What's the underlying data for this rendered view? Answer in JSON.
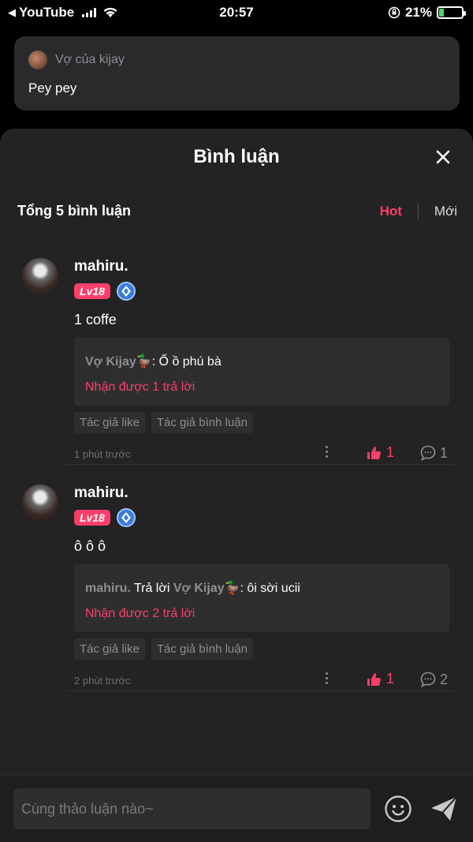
{
  "status_bar": {
    "back_app": "YouTube",
    "time": "20:57",
    "battery_pct": "21%",
    "battery_level": 0.21
  },
  "top_message": {
    "username": "Vợ của kijay",
    "text": "Pey pey"
  },
  "sheet": {
    "title": "Bình luận",
    "total_label": "Tổng 5 bình luận",
    "sort_hot": "Hot",
    "sort_new": "Mới"
  },
  "comments": [
    {
      "name": "mahiru.",
      "level": "Lv18",
      "text": "1 coffe",
      "reply_prefix_user": "",
      "reply_prefix_text": "",
      "reply_user": "Vợ Kijay🦆",
      "reply_text": ": Ố ồ phú bà",
      "reply_more": "Nhận được 1 trả lời",
      "tag_like": "Tác giả like",
      "tag_comment": "Tác giả bình luận",
      "time": "1 phút trước",
      "likes": "1",
      "replies": "1"
    },
    {
      "name": "mahiru.",
      "level": "Lv18",
      "text": "ô ô ô",
      "reply_prefix_user": "mahiru.",
      "reply_prefix_text": " Trả lời ",
      "reply_user": "Vợ Kijay🦆",
      "reply_text": ": ôi sời ucii",
      "reply_more": "Nhận được 2 trả lời",
      "tag_like": "Tác giả like",
      "tag_comment": "Tác giả bình luận",
      "time": "2 phút trước",
      "likes": "1",
      "replies": "2"
    }
  ],
  "input": {
    "placeholder": "Cùng thảo luận nào~"
  },
  "colors": {
    "accent": "#ff3f6a",
    "sheet_bg": "#232323",
    "card_bg": "#2e2e2e"
  }
}
